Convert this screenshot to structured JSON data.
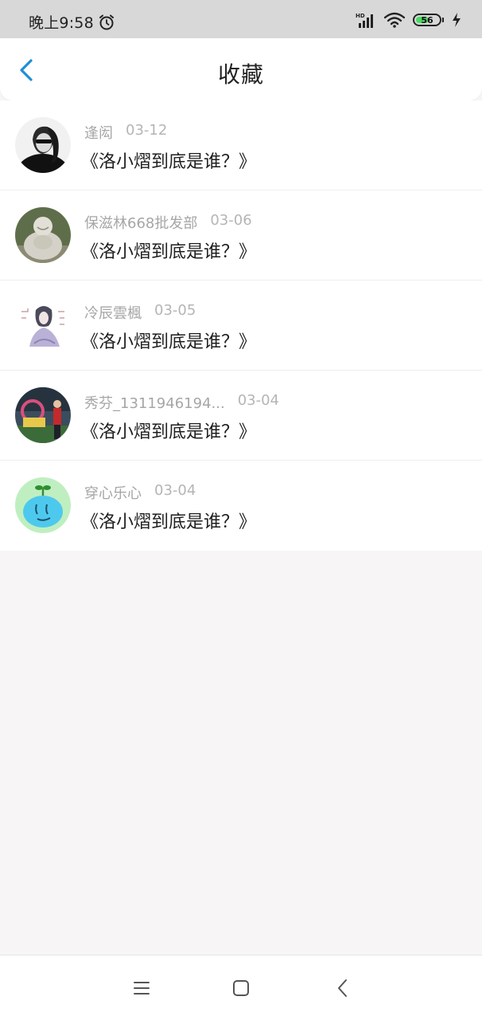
{
  "status_bar": {
    "time": "晚上9:58",
    "hd_label": "HD",
    "battery_level": "56",
    "battery_fraction": 0.56,
    "icons": [
      "alarm-icon",
      "signal-icon",
      "wifi-icon",
      "battery-icon",
      "charging-icon"
    ]
  },
  "header": {
    "title": "收藏",
    "back_icon": "chevron-left-icon",
    "accent_color": "#1e90d6"
  },
  "favorites": [
    {
      "name": "逢闳",
      "date": "03-12",
      "title": "《洛小熠到底是谁？》",
      "avatar": "avatar-1"
    },
    {
      "name": "保滋林668批发部",
      "date": "03-06",
      "title": "《洛小熠到底是谁？》",
      "avatar": "avatar-2"
    },
    {
      "name": "冷辰雲楓",
      "date": "03-05",
      "title": "《洛小熠到底是谁？》",
      "avatar": "avatar-3"
    },
    {
      "name": "秀芬_1311946194...",
      "date": "03-04",
      "title": "《洛小熠到底是谁？》",
      "avatar": "avatar-4"
    },
    {
      "name": "穿心乐心",
      "date": "03-04",
      "title": "《洛小熠到底是谁？》",
      "avatar": "avatar-5"
    }
  ],
  "nav_bar": {
    "icons": [
      "menu-icon",
      "home-icon",
      "back-icon"
    ]
  }
}
